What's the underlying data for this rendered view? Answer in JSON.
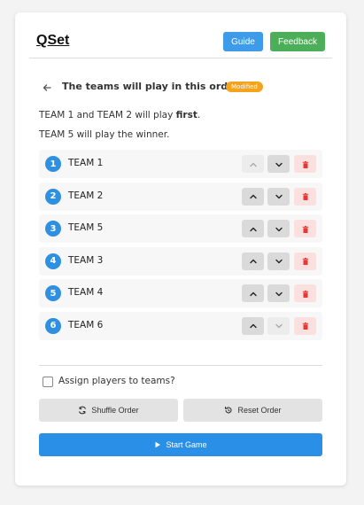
{
  "app": {
    "logo": "QSet"
  },
  "header": {
    "guide_label": "Guide",
    "feedback_label": "Feedback"
  },
  "order": {
    "title": "The teams will play in this order:",
    "badge": "Modified",
    "info_line1_prefix": "TEAM 1 and TEAM 2 will play ",
    "info_line1_emphasis": "first",
    "info_line1_suffix": ".",
    "info_line2": "TEAM 5 will play the winner."
  },
  "teams": [
    {
      "number": "1",
      "name": "TEAM 1",
      "up_enabled": false,
      "down_enabled": true
    },
    {
      "number": "2",
      "name": "TEAM 2",
      "up_enabled": true,
      "down_enabled": true
    },
    {
      "number": "3",
      "name": "TEAM 5",
      "up_enabled": true,
      "down_enabled": true
    },
    {
      "number": "4",
      "name": "TEAM 3",
      "up_enabled": true,
      "down_enabled": true
    },
    {
      "number": "5",
      "name": "TEAM 4",
      "up_enabled": true,
      "down_enabled": true
    },
    {
      "number": "6",
      "name": "TEAM 6",
      "up_enabled": true,
      "down_enabled": false
    }
  ],
  "options": {
    "assign_players_label": "Assign players to teams?",
    "assign_players_checked": false
  },
  "actions": {
    "shuffle_label": "Shuffle Order",
    "reset_label": "Reset Order",
    "start_label": "Start Game"
  },
  "colors": {
    "accent": "#2a8fe6",
    "guide": "#3d9be9",
    "feedback": "#4cae58",
    "badge": "#f3a41c",
    "delete": "#e53935"
  },
  "icons": {
    "back": "arrow-left-icon",
    "up": "chevron-up-icon",
    "down": "chevron-down-icon",
    "delete": "trash-icon",
    "shuffle": "shuffle-icon",
    "reset": "reset-icon",
    "start": "play-icon"
  }
}
